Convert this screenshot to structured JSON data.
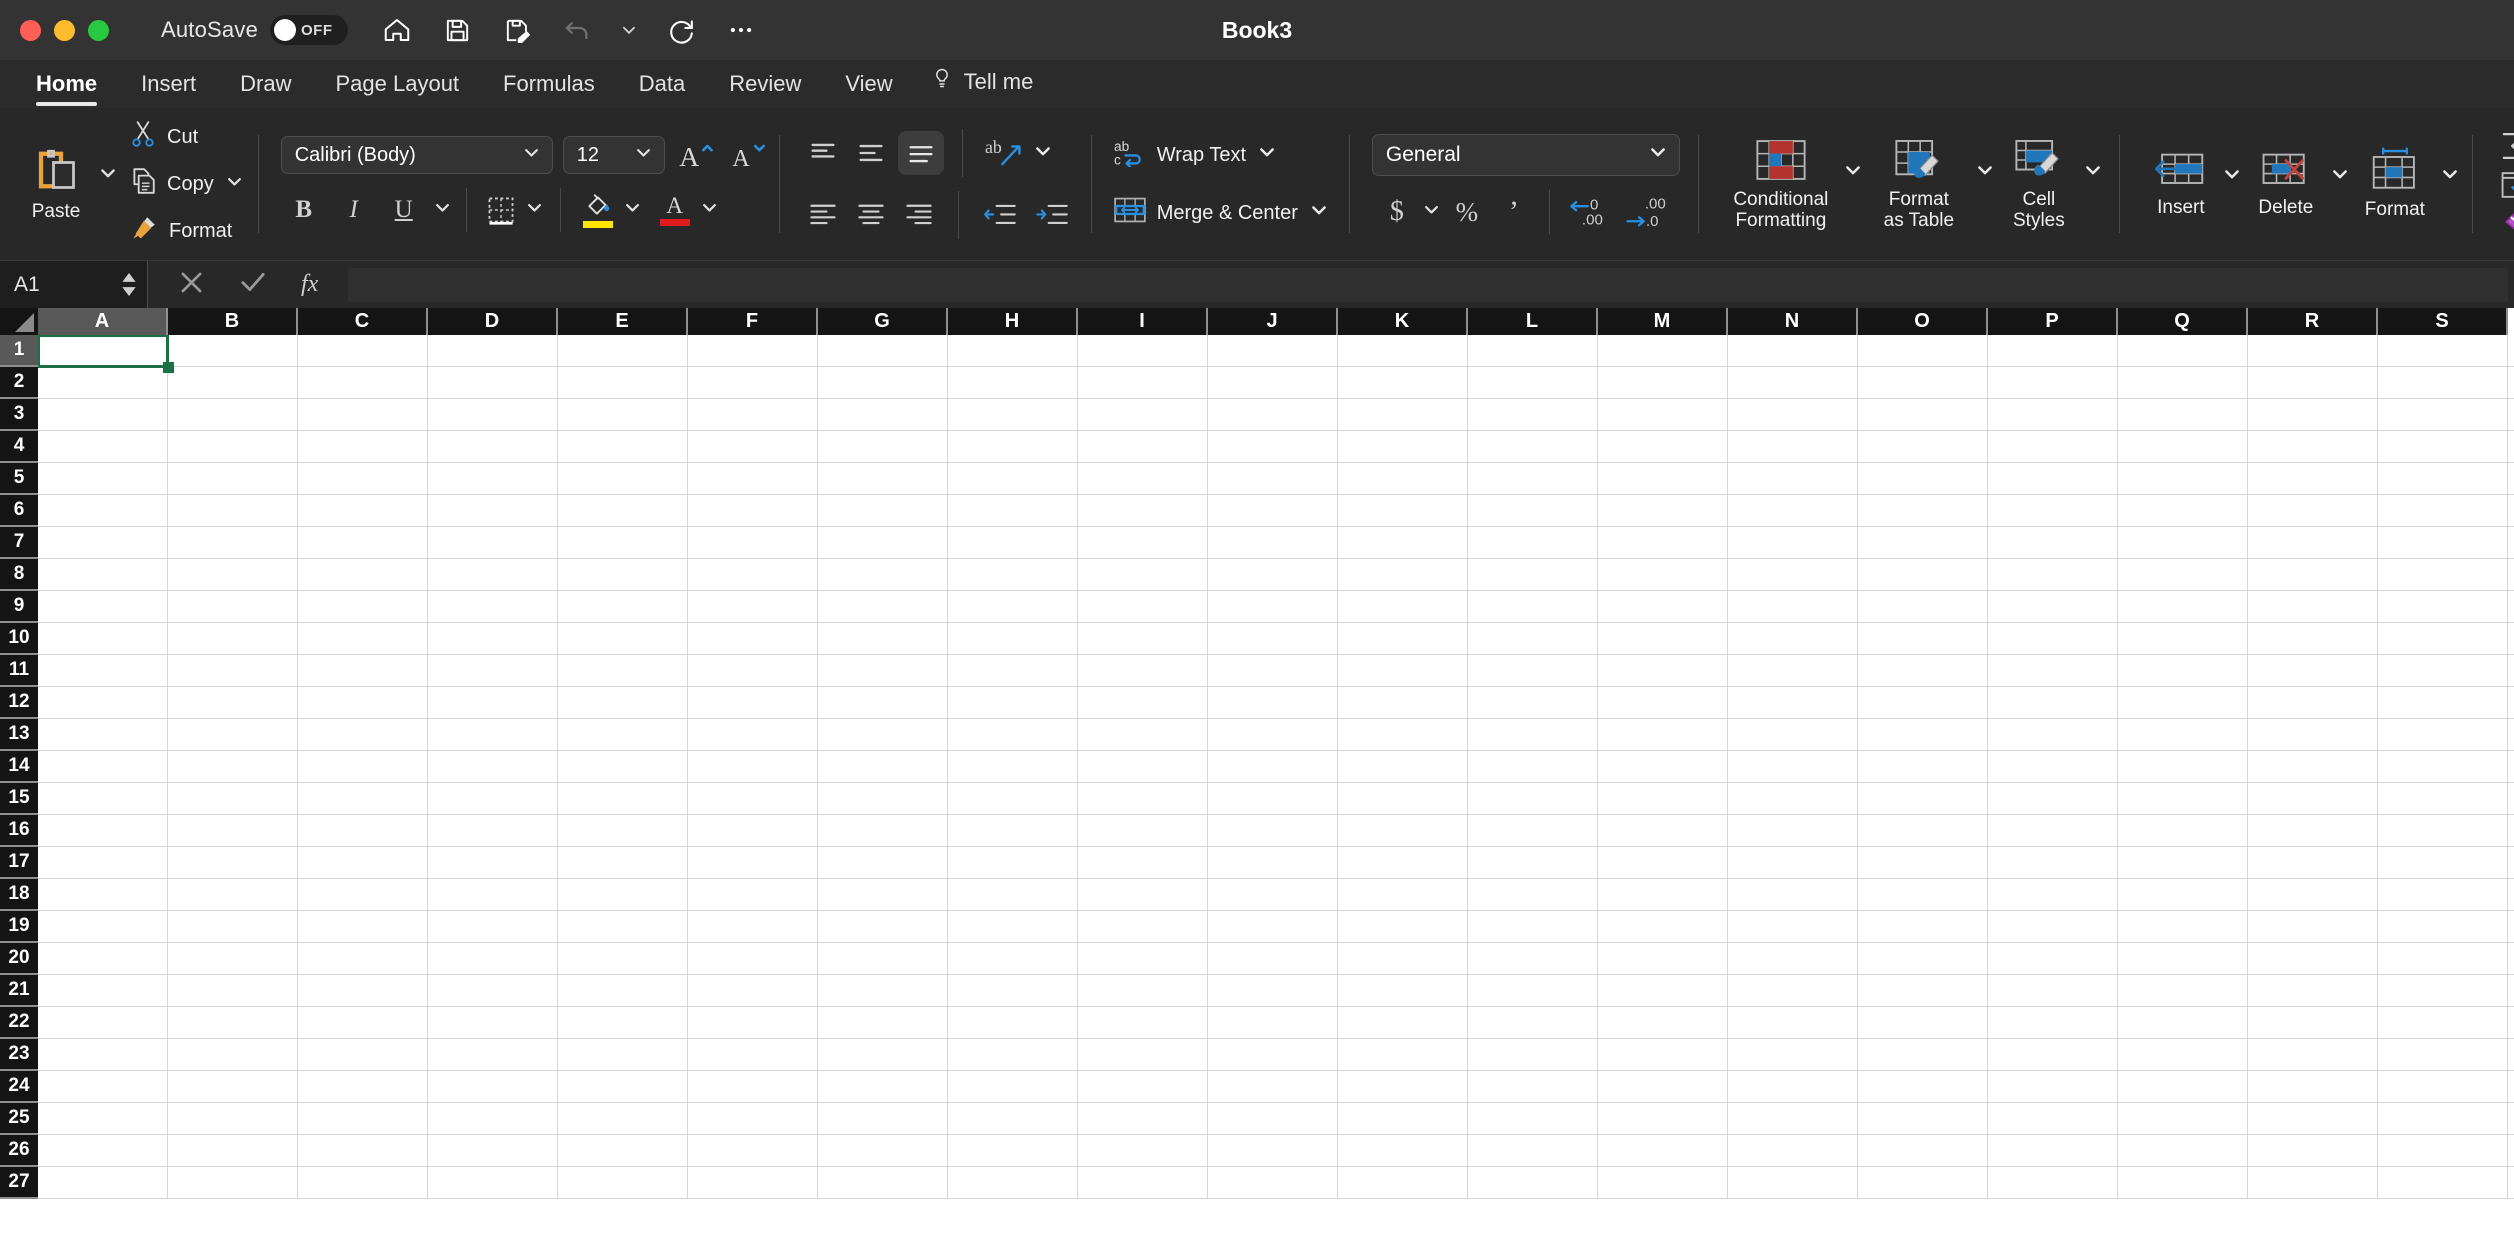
{
  "window": {
    "title": "Book3",
    "traffic_lights": [
      "close",
      "minimize",
      "zoom"
    ],
    "autosave": {
      "label": "AutoSave",
      "state": "OFF"
    },
    "quick_access": [
      "home-icon",
      "save-icon",
      "save-as-icon",
      "undo-icon",
      "undo-dropdown-chevron-icon",
      "redo-icon",
      "more-options-icon"
    ]
  },
  "tabs": [
    {
      "label": "Home",
      "active": true
    },
    {
      "label": "Insert",
      "active": false
    },
    {
      "label": "Draw",
      "active": false
    },
    {
      "label": "Page Layout",
      "active": false
    },
    {
      "label": "Formulas",
      "active": false
    },
    {
      "label": "Data",
      "active": false
    },
    {
      "label": "Review",
      "active": false
    },
    {
      "label": "View",
      "active": false
    },
    {
      "label": "Tell me",
      "active": false,
      "icon": "lightbulb-icon"
    }
  ],
  "ribbon": {
    "clipboard": {
      "paste": "Paste",
      "cut": "Cut",
      "copy": "Copy",
      "format_painter": "Format"
    },
    "font": {
      "family": "Calibri (Body)",
      "size": "12",
      "grow_font": "increase-font-size-icon",
      "shrink_font": "decrease-font-size-icon",
      "bold": "B",
      "italic": "I",
      "underline": "U",
      "borders": "borders-icon",
      "fill_color": "fill-color-icon",
      "font_color": "font-color-icon",
      "fill_swatch": "#ffe500",
      "font_swatch": "#e01b1b"
    },
    "alignment": {
      "align_top": "align-top-icon",
      "align_middle": "align-middle-icon",
      "align_bottom": "align-bottom-icon",
      "orientation": "text-orientation-icon",
      "align_left": "align-left-icon",
      "align_center": "align-center-icon",
      "align_right": "align-right-icon",
      "decrease_indent": "decrease-indent-icon",
      "increase_indent": "increase-indent-icon",
      "wrap_text": "Wrap Text",
      "merge_center": "Merge & Center"
    },
    "number": {
      "format": "General",
      "accounting": "accounting-format-icon",
      "percent": "percent-style-icon",
      "comma": "comma-style-icon",
      "increase_decimal": "increase-decimal-icon",
      "decrease_decimal": "decrease-decimal-icon"
    },
    "styles": {
      "conditional_formatting": "Conditional\nFormatting",
      "conditional_formatting_l1": "Conditional",
      "conditional_formatting_l2": "Formatting",
      "format_as_table_l1": "Format",
      "format_as_table_l2": "as Table",
      "cell_styles_l1": "Cell",
      "cell_styles_l2": "Styles"
    },
    "cells": {
      "insert": "Insert",
      "delete": "Delete",
      "format": "Format"
    },
    "editing": {
      "autosum": "autosum-icon",
      "fill": "fill-icon",
      "clear": "clear-icon"
    }
  },
  "formula_bar": {
    "name_box": "A1",
    "cancel": "cancel-icon",
    "enter": "enter-icon",
    "insert_function": "fx",
    "formula_value": "",
    "formula_placeholder": ""
  },
  "grid": {
    "columns": [
      "A",
      "B",
      "C",
      "D",
      "E",
      "F",
      "G",
      "H",
      "I",
      "J",
      "K",
      "L",
      "M",
      "N",
      "O",
      "P",
      "Q",
      "R",
      "S"
    ],
    "rows": [
      "1",
      "2",
      "3",
      "4",
      "5",
      "6",
      "7",
      "8",
      "9",
      "10",
      "11",
      "12",
      "13",
      "14",
      "15",
      "16",
      "17",
      "18",
      "19",
      "20",
      "21",
      "22",
      "23",
      "24",
      "25",
      "26",
      "27"
    ],
    "selected_cell": "A1",
    "selected_column": "A",
    "selected_row": "1",
    "selection_color": "#1d7044",
    "cell_values": {}
  }
}
